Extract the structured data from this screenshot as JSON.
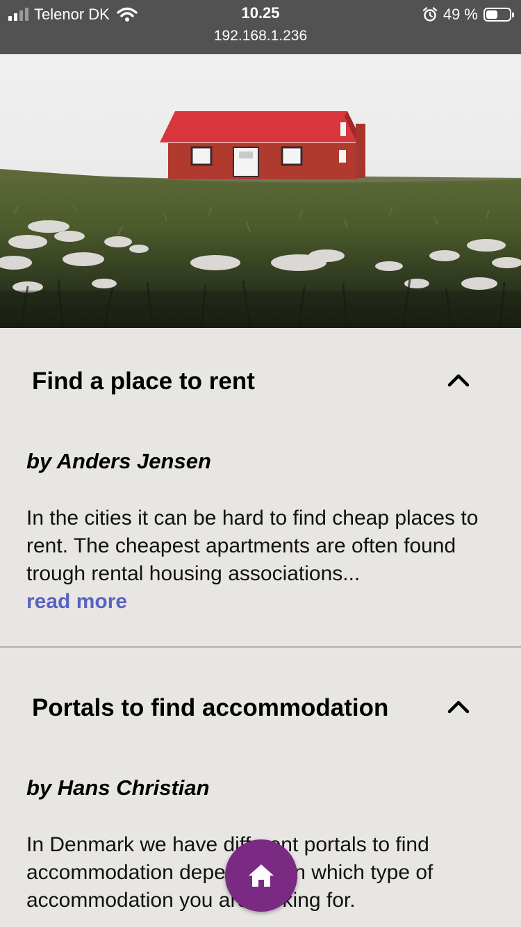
{
  "status_bar": {
    "carrier": "Telenor DK",
    "time": "10.25",
    "url": "192.168.1.236",
    "battery_percent": "49 %",
    "battery_level": 0.49
  },
  "hero": {
    "icon": "house-photo"
  },
  "articles": [
    {
      "title": "Find a place to rent",
      "author": "by Anders Jensen",
      "excerpt": "In the cities it can be hard to find cheap places to rent. The cheapest apartments are often found trough rental housing associations...",
      "read_more": "read more",
      "expanded": true
    },
    {
      "title": "Portals to find accommodation",
      "author": "by Hans Christian",
      "excerpt": "In Denmark we have different portals to find accommodation depending on which type of accommodation you are looking for.",
      "expanded": true
    }
  ],
  "fab": {
    "icon": "home-icon",
    "color": "#7a2a83"
  }
}
